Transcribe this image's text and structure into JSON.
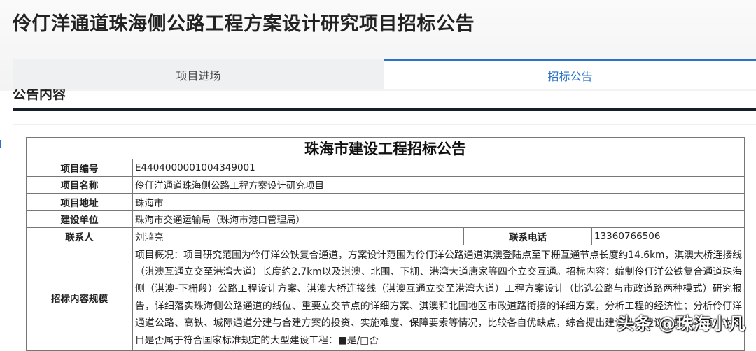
{
  "page": {
    "title": "伶仃洋通道珠海侧公路工程方案设计研究项目招标公告"
  },
  "tabs": [
    {
      "label": "项目进场",
      "active": false
    },
    {
      "label": "招标公告",
      "active": true
    }
  ],
  "section": {
    "title": "公告内容"
  },
  "notice": {
    "heading": "珠海市建设工程招标公告",
    "rows": [
      {
        "label": "项目编号",
        "value": "E4404000001004349001"
      },
      {
        "label": "项目名称",
        "value": "伶仃洋通道珠海侧公路工程方案设计研究项目"
      },
      {
        "label": "项目地址",
        "value": "珠海市"
      },
      {
        "label": "建设单位",
        "value": "珠海市交通运输局（珠海市港口管理局）"
      }
    ],
    "contact": {
      "label": "联系人",
      "value": "刘鸿亮",
      "phone_label": "联系电话",
      "phone_value": "13360766506"
    },
    "scope": {
      "label": "招标内容规模",
      "value": "项目概况：项目研究范围为伶仃洋公铁复合通道，方案设计范围为伶仃洋公路通道淇澳登陆点至下栅互通节点长度约14.6km，淇澳大桥连接线（淇澳互通立交至港湾大道）长度约2.7km以及淇澳、北围、下栅、港湾大道唐家等四个立交互通。招标内容：编制伶仃洋公铁复合通道珠海侧（淇澳-下栅段）公路工程设计方案、淇澳大桥连接线（淇澳互通立交至港湾大道）工程方案设计（比选公路与市政道路两种模式）研究报告，详细落实珠海侧公路通道的线位、重要立交节点的详细方案、淇澳和北围地区市政道路衔接的详细方案，分析工程的经济性；分析伶仃洋通道公路、高铁、城际通道分建与合建方案的投资、实施难度、保障要素等情况，比较各自优缺点，综合提出建设推进建议。其他事项：本项目是否属于符合国家标准规定的大型建设工程：■是/□否"
    }
  },
  "watermark": "头条 @珠海小凡"
}
